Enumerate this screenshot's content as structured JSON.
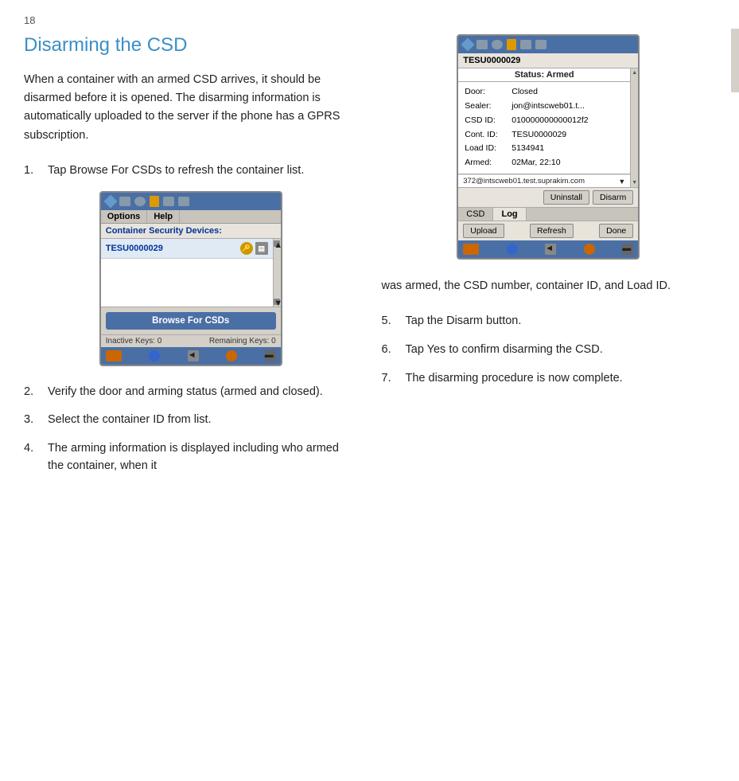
{
  "page": {
    "number": "18",
    "title": "Disarming the CSD"
  },
  "intro": {
    "text": "When a container with an armed CSD arrives, it should be disarmed before it is opened. The disarming information is automatically uploaded to the server if the phone has a GPRS subscription."
  },
  "steps_left": [
    {
      "num": "1.",
      "text": "Tap Browse For CSDs to refresh the container list."
    },
    {
      "num": "2.",
      "text": "Verify the door and arming status (armed and closed)."
    },
    {
      "num": "3.",
      "text": "Select the container ID from list."
    },
    {
      "num": "4.",
      "text": "The arming information is displayed including who armed the container, when it"
    }
  ],
  "steps_right": [
    {
      "num": "5.",
      "text": "Tap the Disarm button."
    },
    {
      "num": "6.",
      "text": "Tap Yes to confirm disarming the CSD."
    },
    {
      "num": "7.",
      "text": "The disarming procedure is now complete."
    }
  ],
  "continuation_text": "was armed, the CSD number, container ID, and Load ID.",
  "phone_left": {
    "menu_items": [
      "Options",
      "Help"
    ],
    "title": "Container Security Devices:",
    "list_item": "TESU0000029",
    "browse_btn": "Browse For CSDs",
    "status_left": "Inactive Keys: 0",
    "status_right": "Remaining Keys: 0"
  },
  "phone_right": {
    "device_id": "TESU0000029",
    "status": "Status: Armed",
    "fields": [
      {
        "label": "Door:",
        "value": "Closed"
      },
      {
        "label": "Sealer:",
        "value": "jon@intscweb01.t..."
      },
      {
        "label": "CSD ID:",
        "value": "010000000000012f2"
      },
      {
        "label": "Cont. ID:",
        "value": "TESU0000029"
      },
      {
        "label": "Load ID:",
        "value": "5134941"
      },
      {
        "label": "Armed:",
        "value": "02Mar, 22:10"
      }
    ],
    "email": "372@intscweb01.test.suprakim.com",
    "action_buttons": [
      "Uninstall",
      "Disarm"
    ],
    "tabs": [
      "CSD",
      "Log"
    ],
    "active_tab": "Log",
    "bottom_buttons": [
      "Upload",
      "Refresh",
      "Done"
    ]
  }
}
